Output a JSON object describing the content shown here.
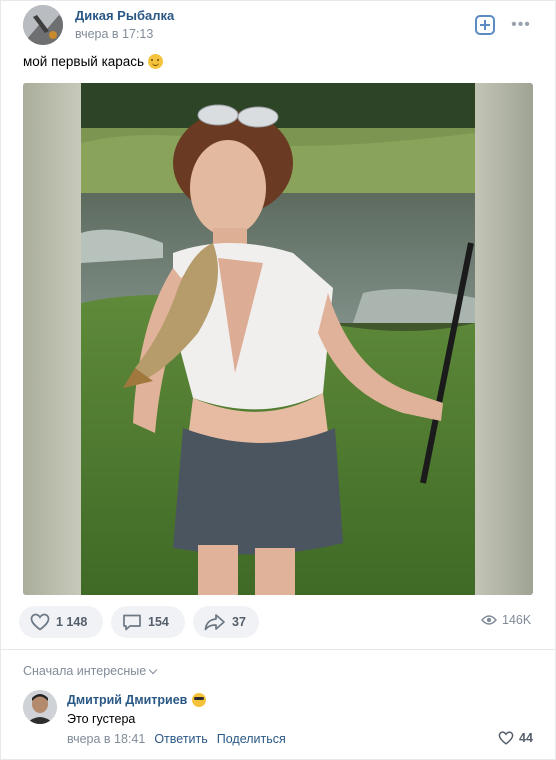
{
  "post": {
    "author": "Дикая Рыбалка",
    "time": "вчера в 17:13",
    "text": "мой первый карась",
    "text_emoji": "smiling-face-emoji",
    "image_description_icon": "photo",
    "actions": {
      "likes": "1 148",
      "comments": "154",
      "shares": "37",
      "views": "146K"
    }
  },
  "comments_section": {
    "sort_label": "Сначала интересные",
    "comment": {
      "author": "Дмитрий Дмитриев",
      "author_emoji": "sunglasses-emoji",
      "text": "Это густера",
      "time": "вчера в 18:41",
      "reply_label": "Ответить",
      "share_label": "Поделиться",
      "likes": "44"
    }
  },
  "colors": {
    "link": "#2a5885",
    "muted": "#818c99",
    "button_bg": "#f0f2f5",
    "accent_icon": "#5a8cc2"
  }
}
